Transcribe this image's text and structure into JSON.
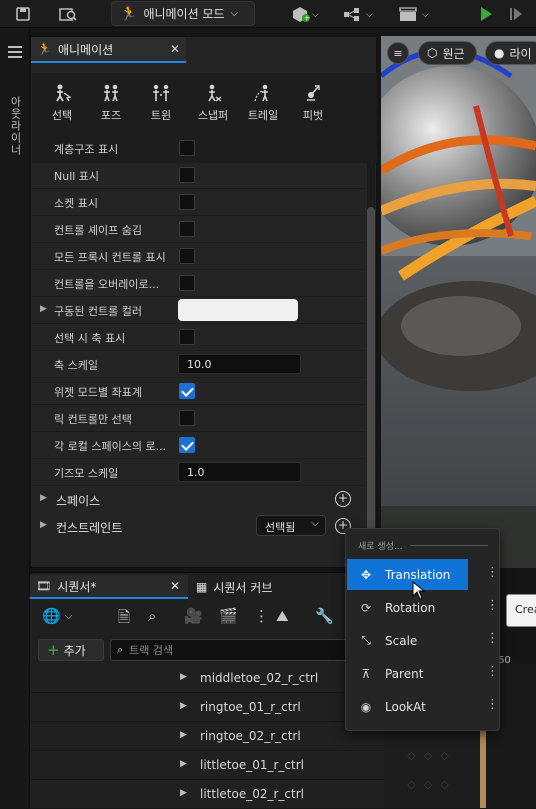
{
  "toolbar": {
    "mode_label": "애니메이션 모드",
    "colors": {
      "play": "#3aa83a"
    }
  },
  "rail": {
    "outliner_label": "아웃라이너"
  },
  "anim_panel": {
    "tab_title": "애니메이션",
    "modes": [
      {
        "label": "선택",
        "icon": "select-icon"
      },
      {
        "label": "포즈",
        "icon": "pose-icon"
      },
      {
        "label": "트윈",
        "icon": "tween-icon"
      },
      {
        "label": "스냅퍼",
        "icon": "snapper-icon"
      },
      {
        "label": "트레일",
        "icon": "trail-icon"
      },
      {
        "label": "피벗",
        "icon": "pivot-icon"
      }
    ],
    "properties": [
      {
        "label": "계층구조 표시",
        "type": "checkbox",
        "checked": false
      },
      {
        "label": "Null 표시",
        "type": "checkbox",
        "checked": false
      },
      {
        "label": "소켓 표시",
        "type": "checkbox",
        "checked": false
      },
      {
        "label": "컨트롤 셰이프 숨김",
        "type": "checkbox",
        "checked": false
      },
      {
        "label": "모든 프록시 컨트롤 표시",
        "type": "checkbox",
        "checked": false
      },
      {
        "label": "컨트롤을 오버레이로...",
        "type": "checkbox",
        "checked": false
      },
      {
        "label": "구동된 컨트롤 컬러",
        "type": "color",
        "value": "#f0f0f0"
      },
      {
        "label": "선택 시 축 표시",
        "type": "checkbox",
        "checked": false
      },
      {
        "label": "축 스케일",
        "type": "number",
        "value": "10.0"
      },
      {
        "label": "위젯 모드별 좌표계",
        "type": "checkbox",
        "checked": true
      },
      {
        "label": "릭 컨트롤만 선택",
        "type": "checkbox",
        "checked": false
      },
      {
        "label": "각 로컬 스페이스의 로...",
        "type": "checkbox",
        "checked": true
      },
      {
        "label": "기즈모 스케일",
        "type": "number",
        "value": "1.0"
      }
    ],
    "sections": {
      "space": "스페이스",
      "constraint": "컨스트레인트",
      "constraint_dropdown": "선택됨"
    }
  },
  "viewport": {
    "perspective_label": "원근",
    "lit_label": "라이"
  },
  "sequencer": {
    "tab1": "시퀀서*",
    "tab2": "시퀀서 커브",
    "add_label": "추가",
    "search_placeholder": "트랙 검색",
    "time_label": "60",
    "tracks": [
      "middletoe_02_r_ctrl",
      "ringtoe_01_r_ctrl",
      "ringtoe_02_r_ctrl",
      "littletoe_01_r_ctrl",
      "littletoe_02_r_ctrl"
    ]
  },
  "menu": {
    "header": "새로 생성...",
    "items": [
      {
        "label": "Translation",
        "icon": "move-icon",
        "selected": true
      },
      {
        "label": "Rotation",
        "icon": "rotate-icon",
        "selected": false
      },
      {
        "label": "Scale",
        "icon": "scale-icon",
        "selected": false
      },
      {
        "label": "Parent",
        "icon": "hierarchy-icon",
        "selected": false
      },
      {
        "label": "LookAt",
        "icon": "eye-icon",
        "selected": false
      }
    ]
  },
  "tooltip": {
    "text": "Crea"
  }
}
